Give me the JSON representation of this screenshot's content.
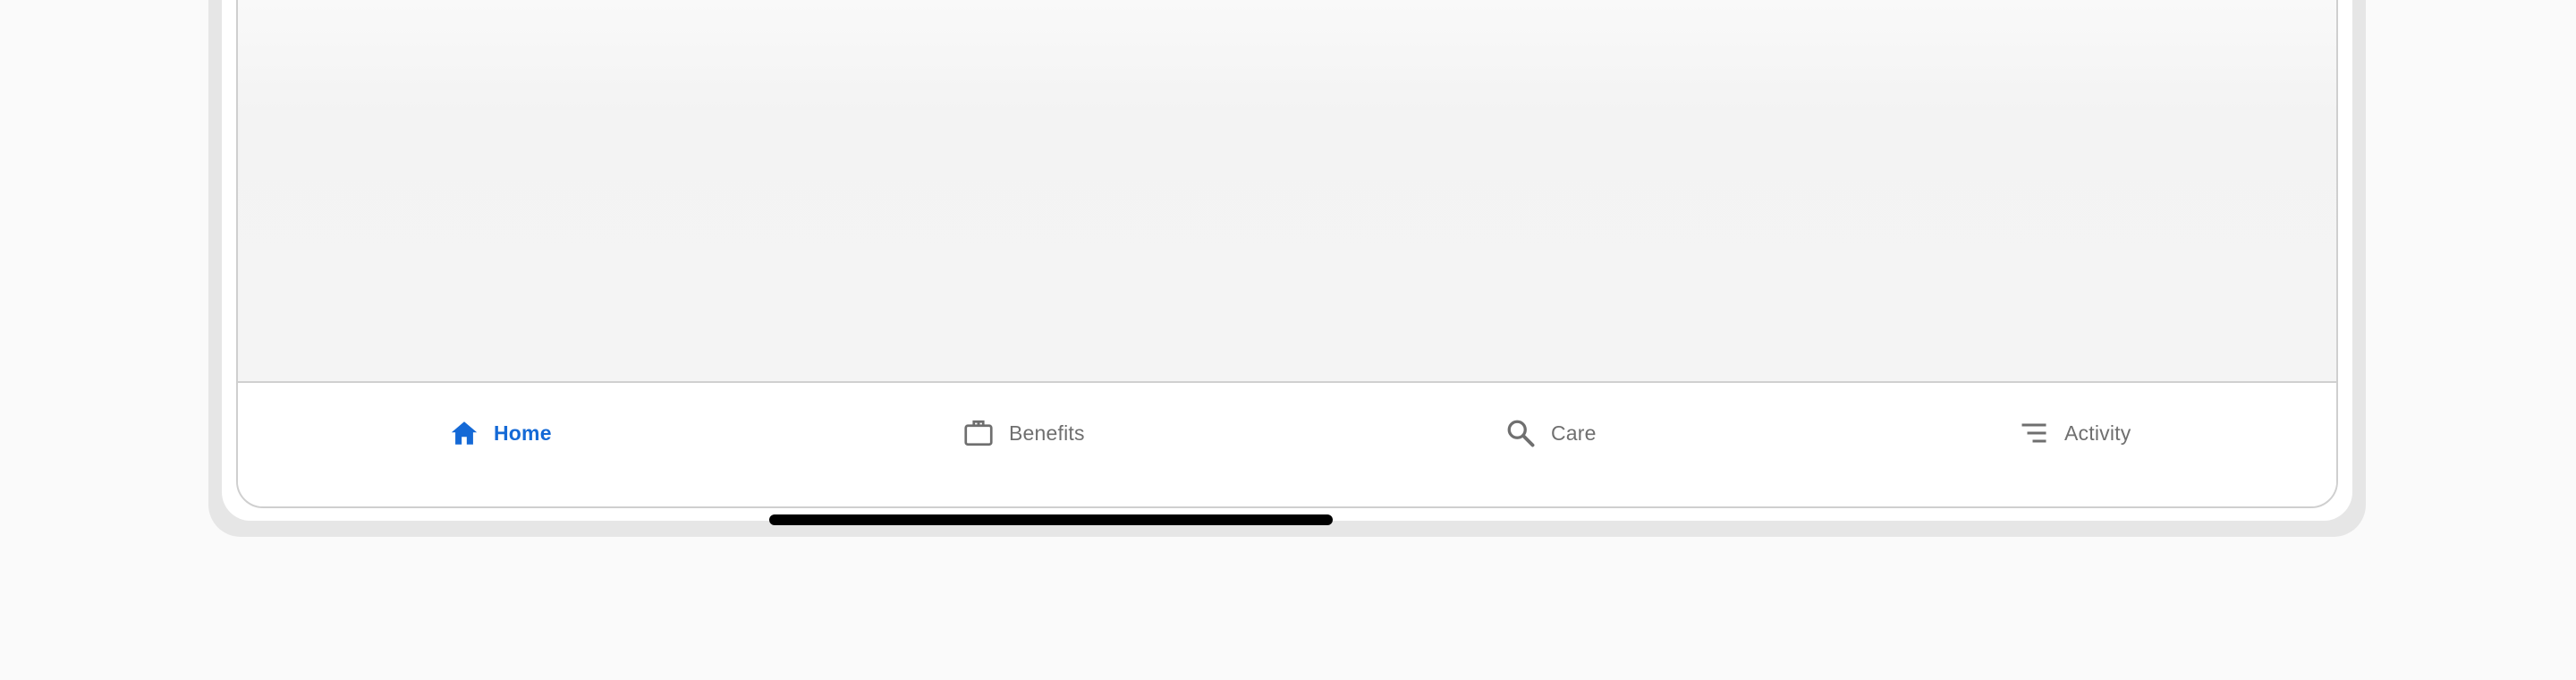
{
  "navigation": {
    "tabs": [
      {
        "label": "Home",
        "icon": "home-icon",
        "active": true
      },
      {
        "label": "Benefits",
        "icon": "briefcase-icon",
        "active": false
      },
      {
        "label": "Care",
        "icon": "search-icon",
        "active": false
      },
      {
        "label": "Activity",
        "icon": "activity-list-icon",
        "active": false
      }
    ]
  },
  "colors": {
    "accent": "#1469d6",
    "inactive": "#6f6f6f",
    "background": "#fafafa",
    "frame": "#e6e6e6"
  }
}
